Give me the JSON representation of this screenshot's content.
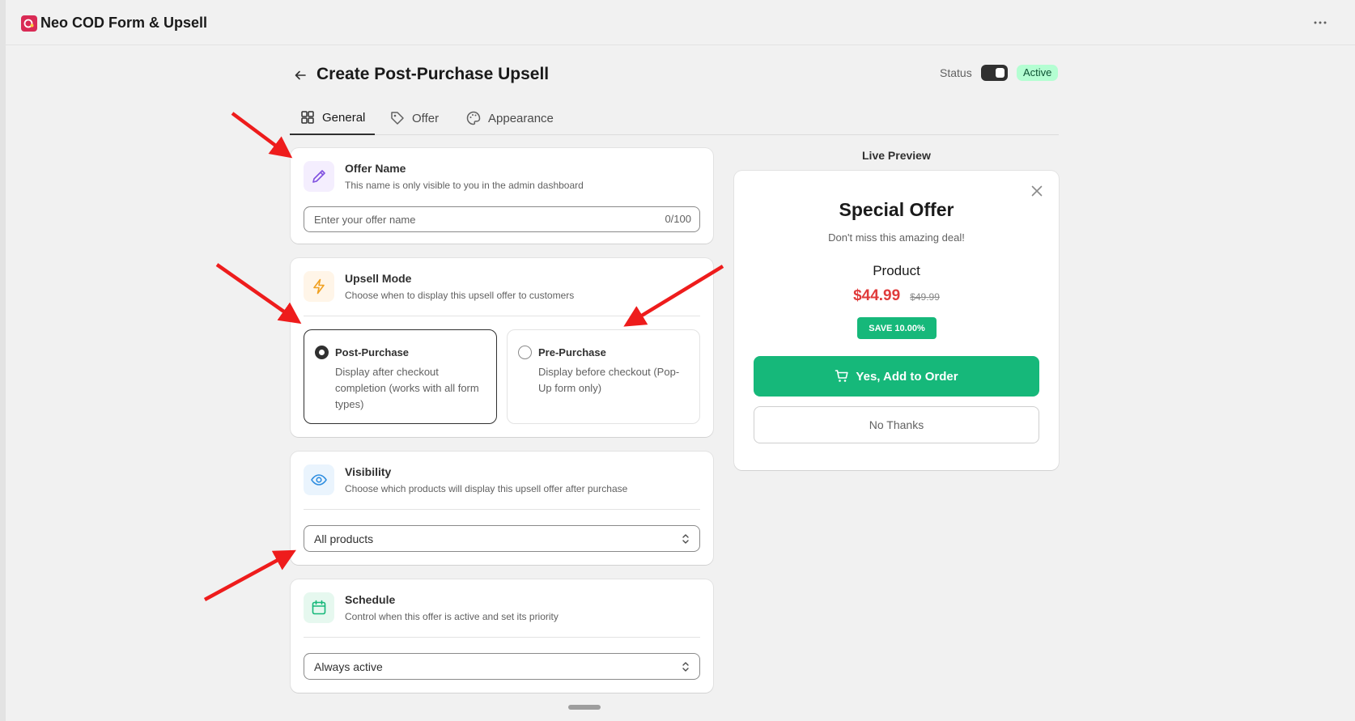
{
  "app": {
    "title": "Neo COD Form & Upsell",
    "logo_icon": "app-logo-icon"
  },
  "header": {
    "more_icon": "more-horizontal-icon"
  },
  "page": {
    "title": "Create Post-Purchase Upsell",
    "status_label": "Status",
    "status_badge": "Active",
    "status_toggle_on": true
  },
  "tabs": [
    {
      "label": "General",
      "icon": "grid-icon",
      "active": true
    },
    {
      "label": "Offer",
      "icon": "tag-icon",
      "active": false
    },
    {
      "label": "Appearance",
      "icon": "palette-icon",
      "active": false
    }
  ],
  "offer_name": {
    "title": "Offer Name",
    "subtitle": "This name is only visible to you in the admin dashboard",
    "placeholder": "Enter your offer name",
    "value": "",
    "count": "0/100",
    "icon": "pencil-icon"
  },
  "upsell_mode": {
    "title": "Upsell Mode",
    "subtitle": "Choose when to display this upsell offer to customers",
    "icon": "lightning-icon",
    "options": [
      {
        "title": "Post-Purchase",
        "desc": "Display after checkout completion (works with all form types)",
        "selected": true
      },
      {
        "title": "Pre-Purchase",
        "desc": "Display before checkout (Pop-Up form only)",
        "selected": false
      }
    ]
  },
  "visibility": {
    "title": "Visibility",
    "subtitle": "Choose which products will display this upsell offer after purchase",
    "icon": "eye-icon",
    "selected": "All products"
  },
  "schedule": {
    "title": "Schedule",
    "subtitle": "Control when this offer is active and set its priority",
    "icon": "calendar-icon",
    "selected": "Always active"
  },
  "preview": {
    "label": "Live Preview",
    "title": "Special Offer",
    "subtitle": "Don't miss this amazing deal!",
    "product": "Product",
    "price": "$44.99",
    "old_price": "$49.99",
    "save_badge": "SAVE 10.00%",
    "yes_button": "Yes, Add to Order",
    "no_button": "No Thanks"
  },
  "colors": {
    "accent_green": "#16b87a",
    "price_red": "#e03b3b",
    "annotation_red": "#ee1c1c",
    "badge_bg": "#b4fed2"
  }
}
